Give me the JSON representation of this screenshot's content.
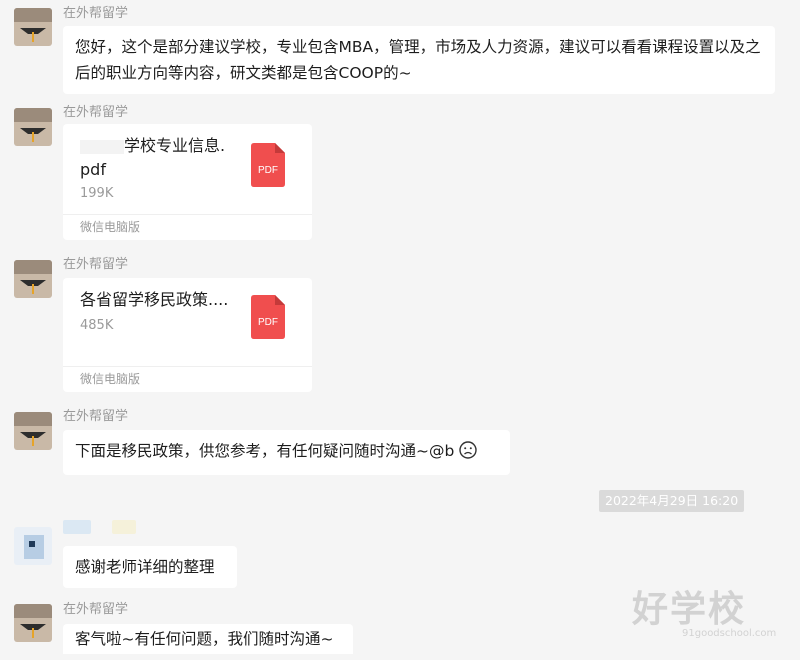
{
  "conversation": {
    "sender_name": "在外帮留学",
    "messages": [
      {
        "type": "text",
        "text": "您好，这个是部分建议学校，专业包含MBA，管理，市场及人力资源，建议可以看看课程设置以及之后的职业方向等内容，研文类都是包含COOP的~"
      },
      {
        "type": "file",
        "file_name_line1": "学校专业信息.",
        "file_name_line2": "pdf",
        "size": "199K",
        "badge": "PDF",
        "footer": "微信电脑版"
      },
      {
        "type": "file",
        "file_name_line1": "各省留学移民政策....",
        "size": "485K",
        "badge": "PDF",
        "footer": "微信电脑版"
      },
      {
        "type": "text",
        "text": "下面是移民政策，供您参考，有任何疑问随时沟通~@b"
      },
      {
        "type": "timestamp",
        "text": "2022年4月29日 16:20"
      },
      {
        "type": "text",
        "text": "感谢老师详细的整理"
      },
      {
        "type": "text",
        "text": "客气啦~有任何问题，我们随时沟通~"
      }
    ]
  },
  "watermark": {
    "main": "好学校",
    "sub": "91goodschool.com"
  },
  "colors": {
    "background": "#f5f5f5",
    "bubble": "#ffffff",
    "pdf_icon": "#f04e4e",
    "muted_text": "#9a9a9a"
  }
}
